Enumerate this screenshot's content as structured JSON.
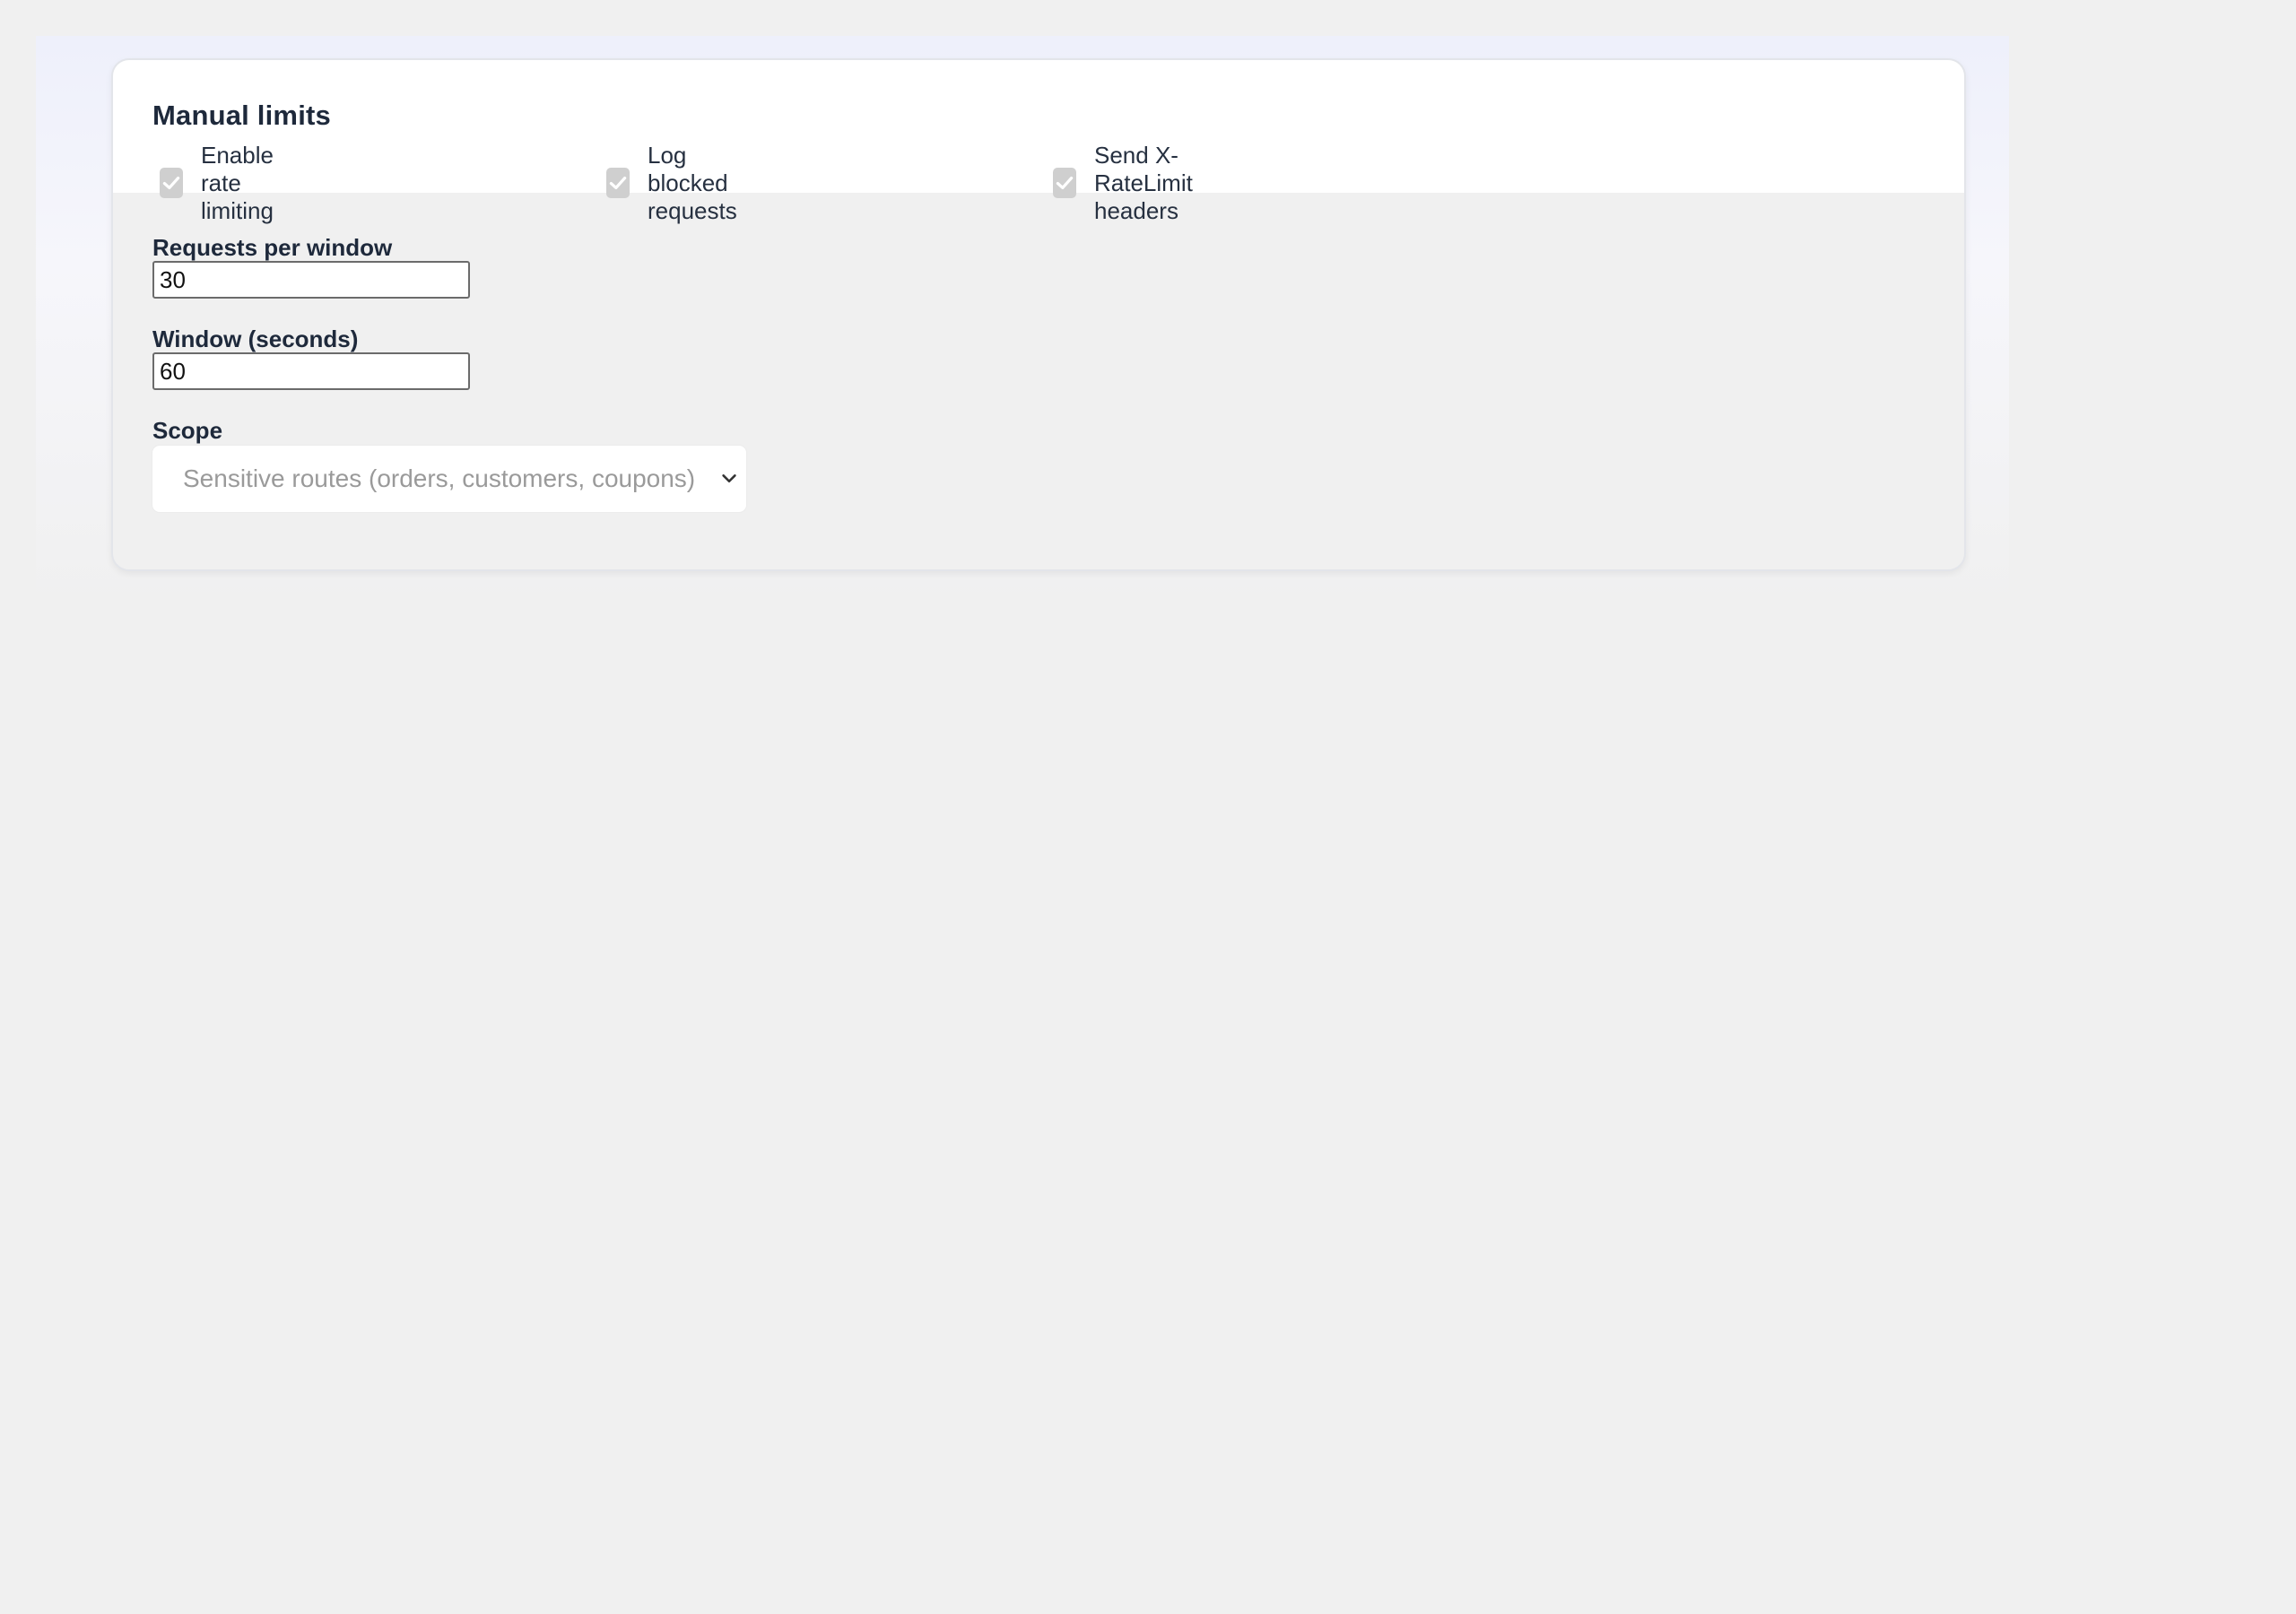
{
  "section": {
    "title": "Manual limits"
  },
  "checkboxes": [
    {
      "label": "Enable rate limiting",
      "checked": true
    },
    {
      "label": "Log blocked requests",
      "checked": true
    },
    {
      "label": "Send X-RateLimit headers",
      "checked": true
    }
  ],
  "fields": {
    "requests_per_window": {
      "label": "Requests per window",
      "value": "30"
    },
    "window_seconds": {
      "label": "Window (seconds)",
      "value": "60"
    },
    "scope": {
      "label": "Scope",
      "value": "Sensitive routes (orders, customers, coupons)"
    }
  },
  "icons": {
    "checkbox": "check-icon",
    "select": "chevron-down-icon"
  },
  "colors": {
    "page_background": "#f0f0f0",
    "card_header_background": "#ffffff",
    "checkbox_fill": "#cfcfcf",
    "title_text": "#1e293b",
    "placeholder_text": "#9a9a9a"
  }
}
